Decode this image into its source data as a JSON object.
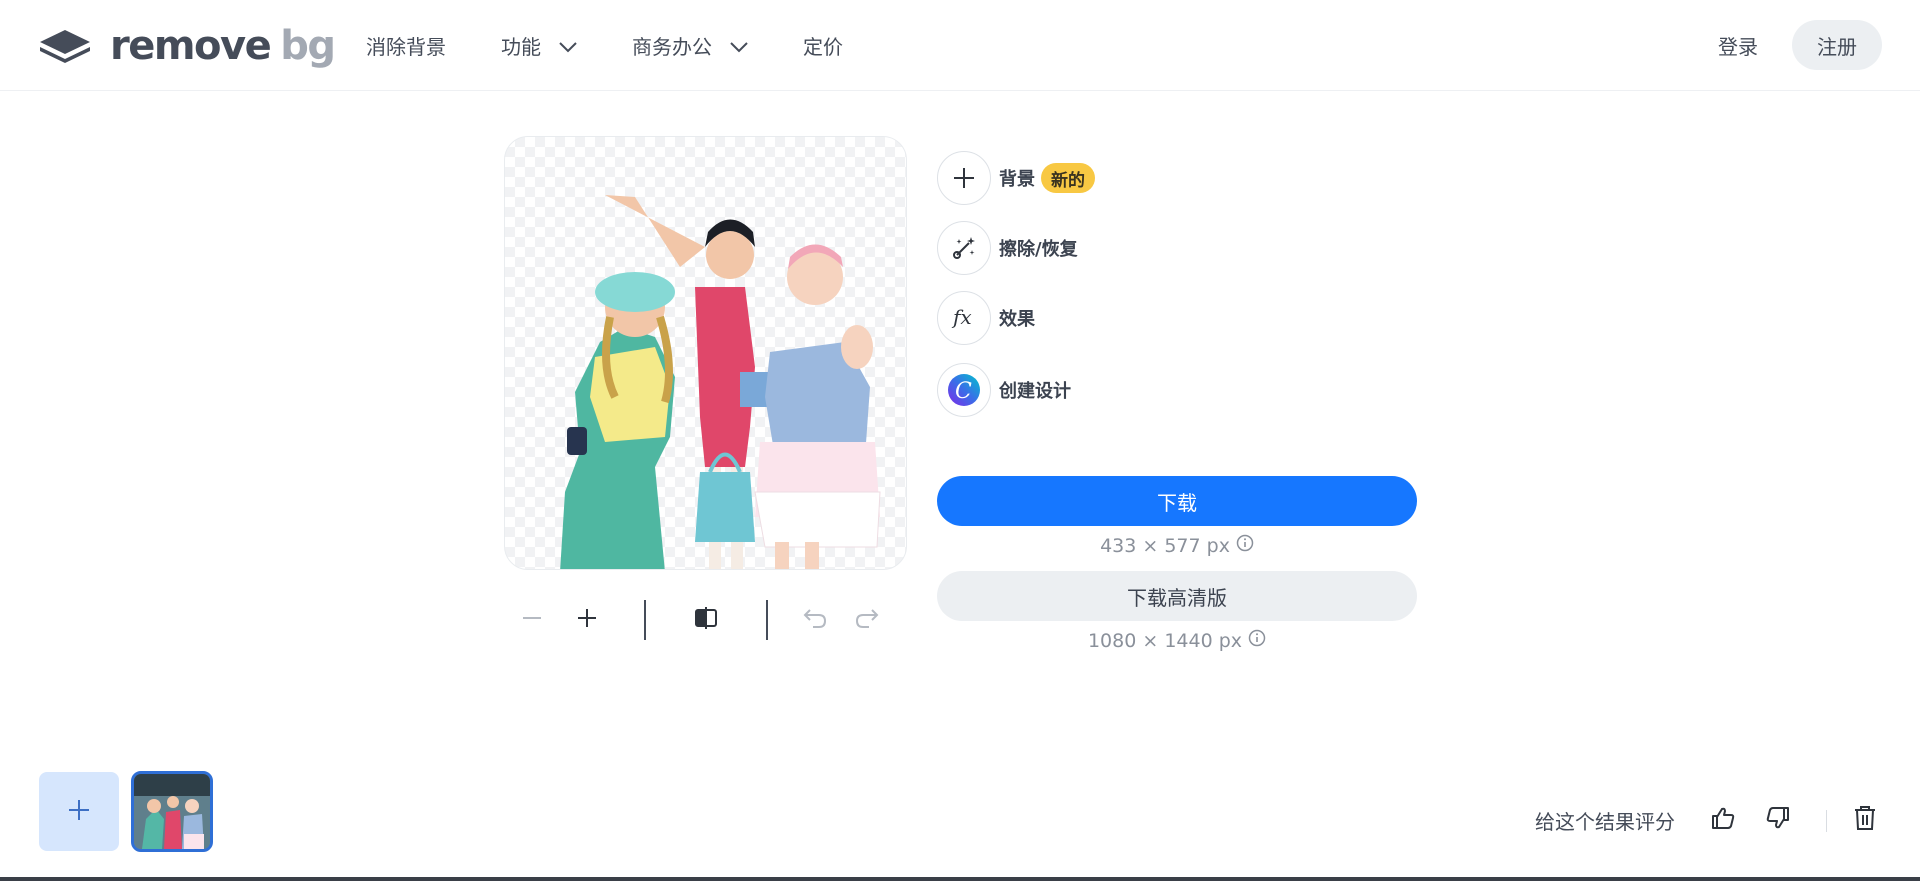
{
  "header": {
    "logo": {
      "word1": "remove",
      "word2": "bg"
    },
    "nav": [
      {
        "label": "消除背景",
        "has_dropdown": false
      },
      {
        "label": "功能",
        "has_dropdown": true
      },
      {
        "label": "商务办公",
        "has_dropdown": true
      },
      {
        "label": "定价",
        "has_dropdown": false
      }
    ],
    "login_label": "登录",
    "signup_label": "注册"
  },
  "tools": {
    "background": {
      "label": "背景",
      "badge": "新的",
      "icon": "plus-icon"
    },
    "erase_restore": {
      "label": "擦除/恢复",
      "icon": "magic-brush-icon"
    },
    "effects": {
      "label": "效果",
      "icon": "fx-icon"
    },
    "create_design": {
      "label": "创建设计",
      "icon": "canva-logo-icon"
    }
  },
  "download": {
    "label": "下载",
    "size_text": "433 × 577 px",
    "hd_label": "下载高清版",
    "hd_size_text": "1080 × 1440 px"
  },
  "zoom_bar": {
    "icons": [
      "zoom-out-icon",
      "zoom-in-icon",
      "compare-icon",
      "undo-icon",
      "redo-icon"
    ]
  },
  "footer": {
    "rate_label": "给这个结果评分",
    "icons": [
      "thumbs-up-icon",
      "thumbs-down-icon",
      "trash-icon"
    ]
  },
  "colors": {
    "primary": "#1677ff",
    "badge": "#f8c843",
    "text": "#454c59",
    "muted": "#8a909a",
    "thumb_border": "#2f6fd6"
  }
}
